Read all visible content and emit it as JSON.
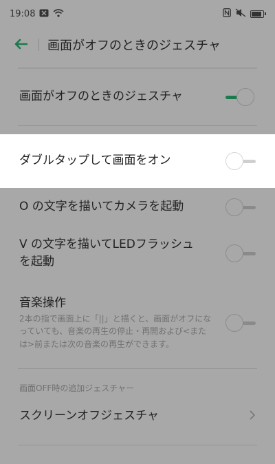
{
  "status": {
    "time": "19:08",
    "icons": [
      "notification-icon",
      "wifi-icon",
      "nfc-icon",
      "mute-icon",
      "battery-icon"
    ]
  },
  "appbar": {
    "title": "画面がオフのときのジェスチャ"
  },
  "rows": {
    "master": {
      "label": "画面がオフのときのジェスチャ",
      "on": true
    },
    "double_tap": {
      "label": "ダブルタップして画面をオン",
      "on": false
    },
    "draw_o": {
      "label": "O の文字を描いてカメラを起動",
      "on": false
    },
    "draw_v_line1": "V の文字を描いてLEDフラッシュ",
    "draw_v_line2": "を起動",
    "music_title": "音楽操作",
    "music_desc": "2本の指で画面上に「||」と描くと、画面がオフになっていても、音楽の再生の停止・再開および<または>前または次の音楽の再生ができます。"
  },
  "section": {
    "header": "画面OFF時の追加ジェスチャー",
    "screen_off_label": "スクリーンオフジェスチャ"
  },
  "colors": {
    "accent": "#1a7a4c",
    "dim_background": "#a8a8a8",
    "highlight": "#ffffff"
  }
}
